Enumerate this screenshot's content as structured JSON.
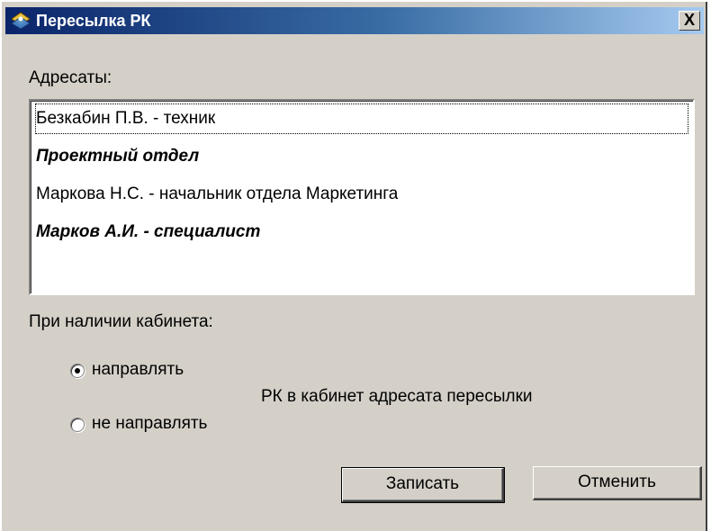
{
  "window": {
    "title": "Пересылка РК",
    "close_label": "X"
  },
  "addressees": {
    "label": "Адресаты:",
    "items": [
      {
        "text": "Безкабин П.В. - техник",
        "bold": false,
        "focused": true
      },
      {
        "text": "Проектный отдел",
        "bold": true,
        "focused": false
      },
      {
        "text": "Маркова Н.С. - начальник отдела Маркетинга",
        "bold": false,
        "focused": false
      },
      {
        "text": "Марков А.И. - специалист",
        "bold": true,
        "focused": false
      }
    ]
  },
  "cabinet": {
    "label": "При наличии кабинета:",
    "options": [
      {
        "label": "направлять",
        "selected": true
      },
      {
        "label": "не направлять",
        "selected": false
      }
    ],
    "suffix": "РК в кабинет адресата пересылки"
  },
  "buttons": {
    "save_label": "Записать",
    "cancel_label": "Отменить"
  }
}
